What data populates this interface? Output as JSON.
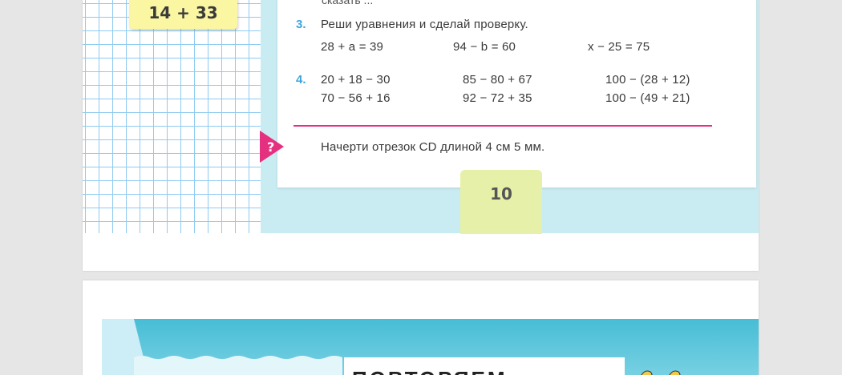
{
  "page_top": {
    "card_expression": "14 + 33",
    "cut_line_text": "сказать ...",
    "task3": {
      "number": "3.",
      "instruction": "Реши уравнения и сделай проверку.",
      "equations": [
        "28 + a = 39",
        "94 − b = 60",
        "x − 25 = 75"
      ]
    },
    "task4": {
      "number": "4.",
      "row1": [
        "20 + 18 − 30",
        "85 − 80 + 67",
        "100 − (28 + 12)"
      ],
      "row2": [
        "70 − 56 + 16",
        "92 − 72 + 35",
        "100 − (49 + 21)"
      ]
    },
    "question_badge": "?",
    "question_text": "Начерти отрезок CD длиной 4 см 5 мм.",
    "page_number": "10"
  },
  "page_bottom": {
    "banner_title": "ПОВТОРЯЕМ"
  },
  "colors": {
    "task_number": "#3aa6dd",
    "accent_pink": "#e5307f",
    "card_yellow": "#fbf6a2",
    "tab_green": "#e7f0a8",
    "spine_cyan": "#c9ecf2",
    "banner_blue": "#47bdd6"
  }
}
